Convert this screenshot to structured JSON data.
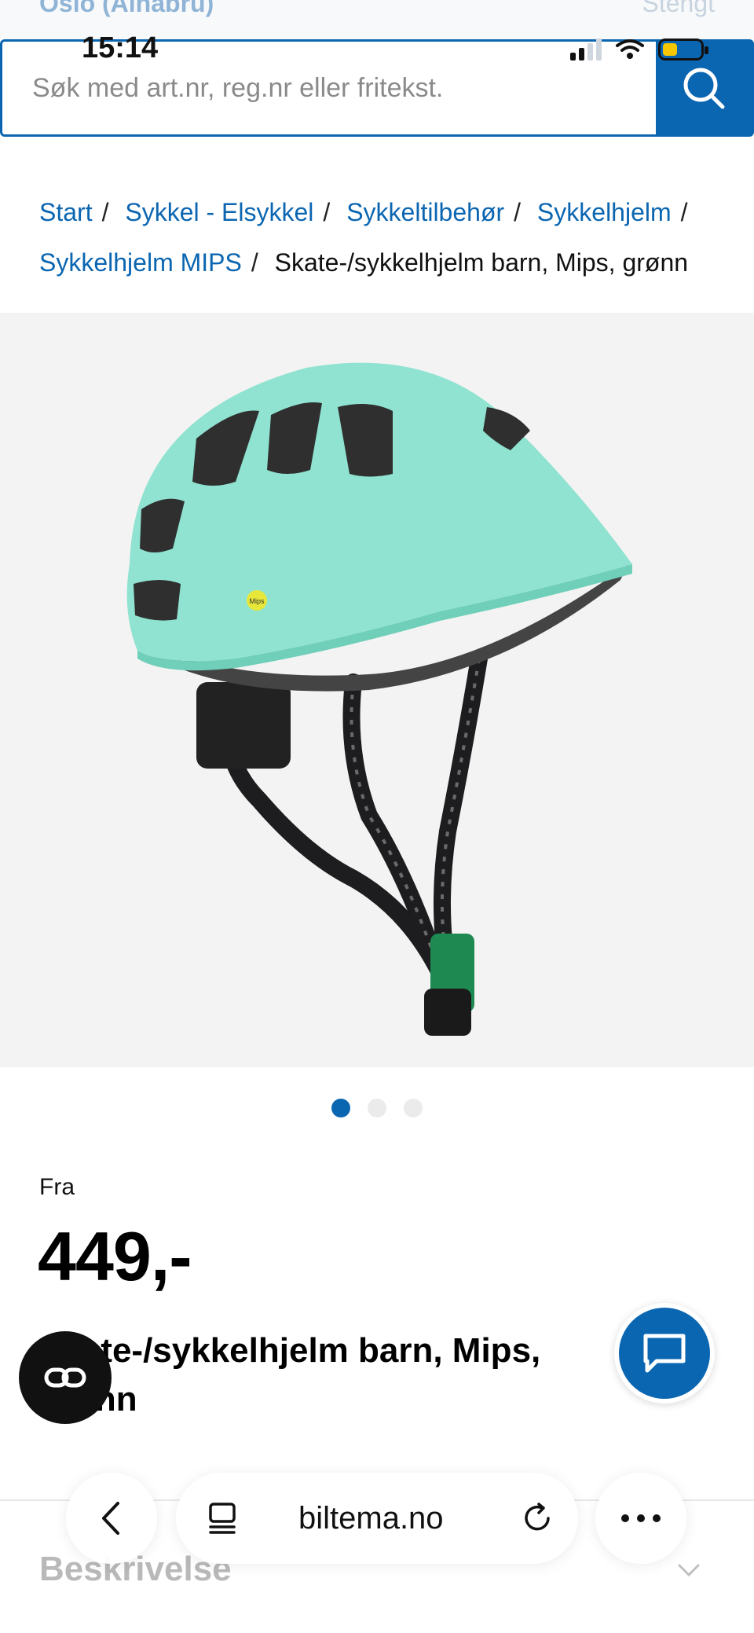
{
  "header": {
    "store_name": "Oslo (Alnabru)",
    "store_status": "Stengt"
  },
  "status_bar": {
    "time": "15:14"
  },
  "search": {
    "placeholder": "Søk med art.nr, reg.nr eller fritekst."
  },
  "breadcrumb": {
    "items": [
      "Start",
      "Sykkel - Elsykkel",
      "Sykkeltilbehør",
      "Sykkelhjelm",
      "Sykkelhjelm MIPS"
    ],
    "current": "Skate-/sykkelhjelm barn, Mips, grønn",
    "separator": "/"
  },
  "gallery": {
    "image_count": 3,
    "active_index": 0
  },
  "product": {
    "price_prefix": "Fra",
    "price": "449,-",
    "title": "Skate-/sykkelhjelm barn, Mips, grønn"
  },
  "sections": {
    "description_label": "Beskrivelse"
  },
  "browser": {
    "url": "biltema.no"
  },
  "colors": {
    "brand_blue": "#0b66b2",
    "helmet_mint": "#8fe3d0"
  }
}
